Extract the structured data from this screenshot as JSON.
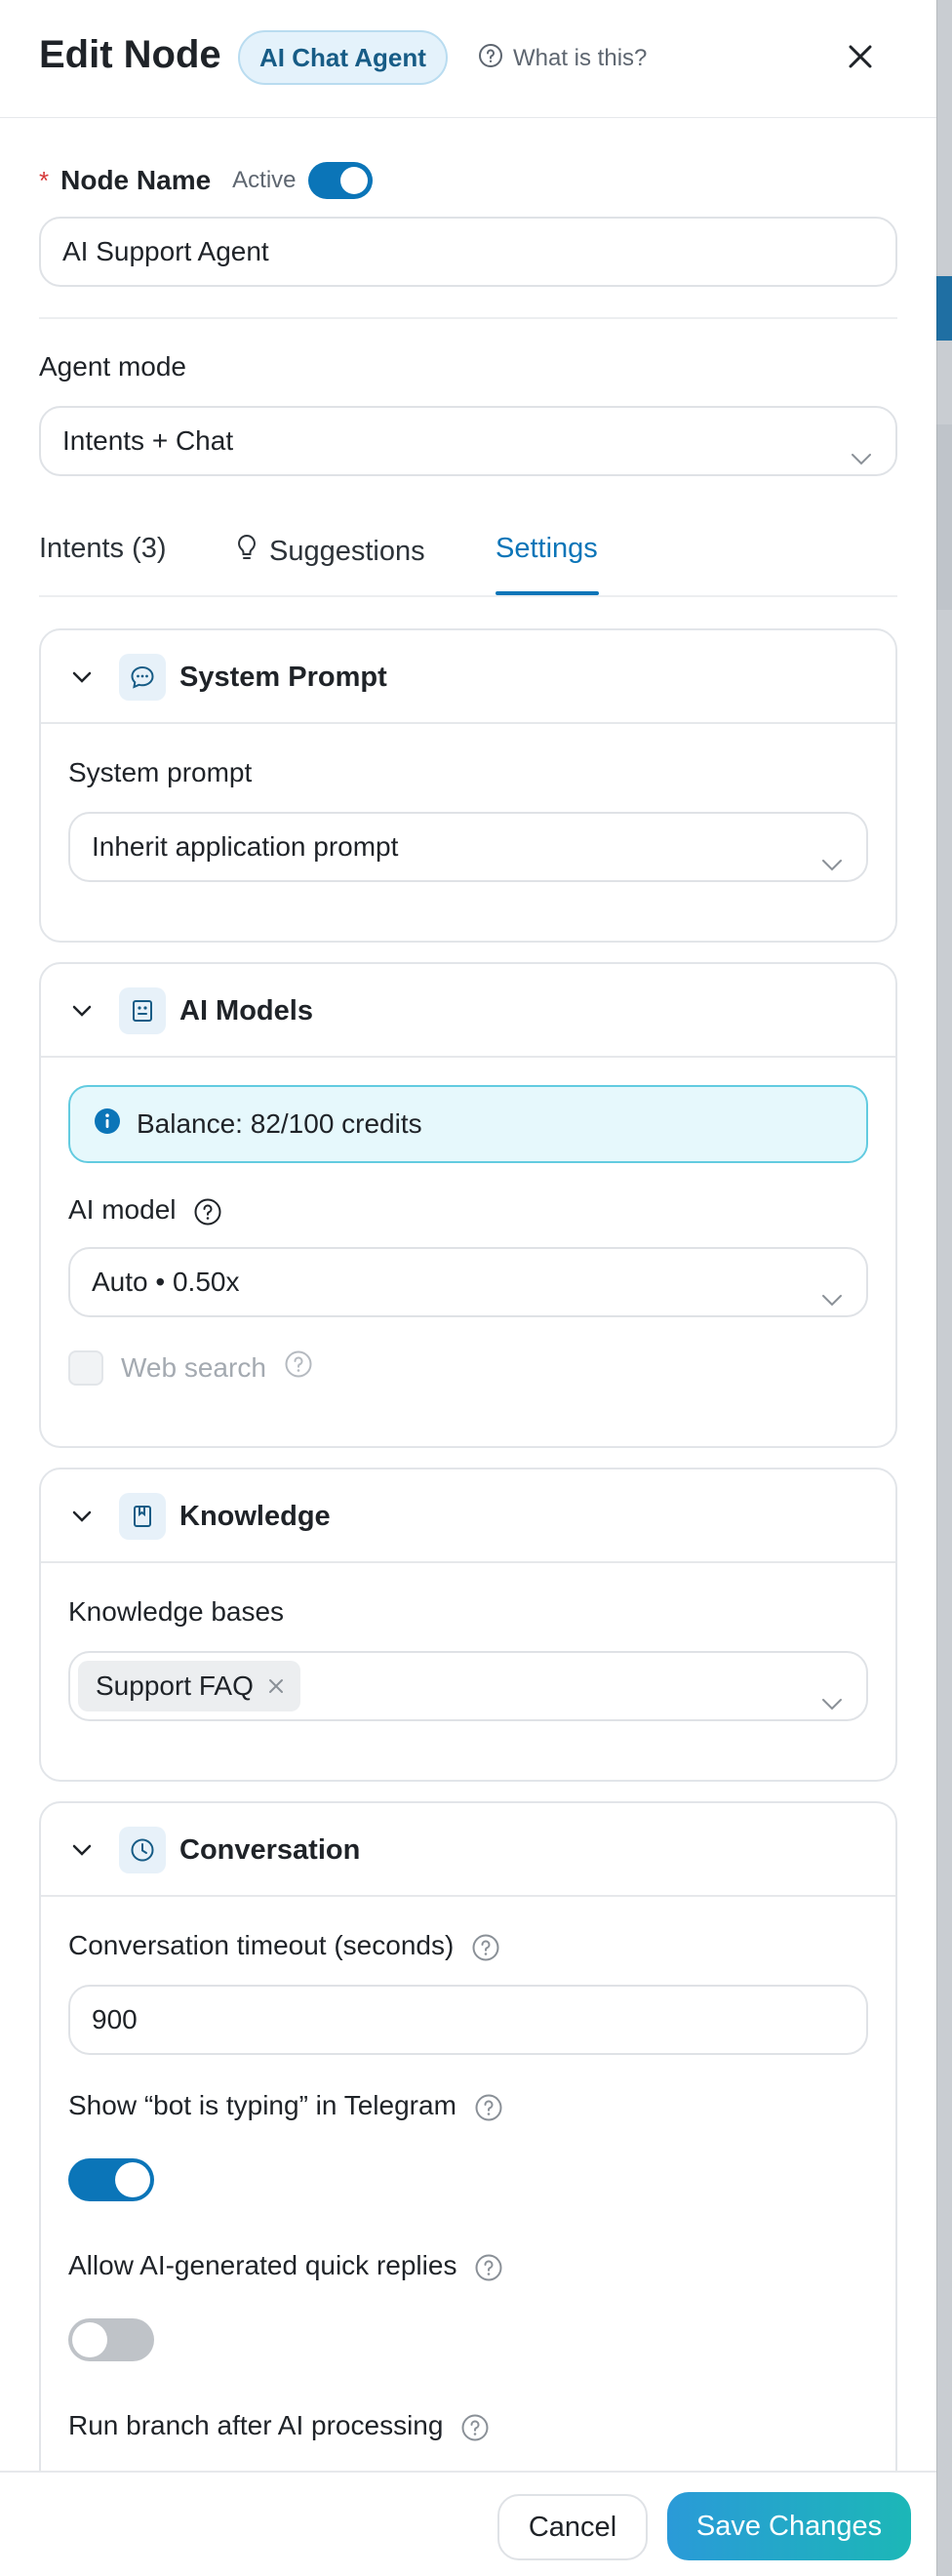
{
  "header": {
    "title": "Edit Node",
    "node_type": "AI Chat Agent",
    "help_link": "What is this?"
  },
  "node_name": {
    "label": "Node Name",
    "required_mark": "*",
    "active_label": "Active",
    "active": true,
    "value": "AI Support Agent"
  },
  "agent_mode": {
    "label": "Agent mode",
    "value": "Intents + Chat"
  },
  "tabs": [
    {
      "label": "Intents (3)",
      "active": false
    },
    {
      "label": "Suggestions",
      "active": false
    },
    {
      "label": "Settings",
      "active": true
    }
  ],
  "sections": {
    "system_prompt": {
      "title": "System Prompt",
      "field_label": "System prompt",
      "value": "Inherit application prompt"
    },
    "ai_models": {
      "title": "AI Models",
      "balance": "Balance: 82/100 credits",
      "model_label": "AI model",
      "model_value": "Auto • 0.50x",
      "web_search_label": "Web search",
      "web_search_checked": false
    },
    "knowledge": {
      "title": "Knowledge",
      "field_label": "Knowledge bases",
      "selected": [
        "Support FAQ"
      ]
    },
    "conversation": {
      "title": "Conversation",
      "timeout_label": "Conversation timeout (seconds)",
      "timeout_value": "900",
      "typing_label": "Show “bot is typing” in Telegram",
      "typing_on": true,
      "quick_replies_label": "Allow AI-generated quick replies",
      "quick_replies_on": false,
      "run_branch_label": "Run branch after AI processing"
    }
  },
  "footer": {
    "cancel_label": "Cancel",
    "save_label": "Save Changes"
  },
  "colors": {
    "accent": "#0b75b8",
    "save_gradient_start": "#2a9ad8",
    "save_gradient_end": "#1cb7b7",
    "info_bg": "#e6f8fc",
    "info_border": "#62cbe0"
  }
}
